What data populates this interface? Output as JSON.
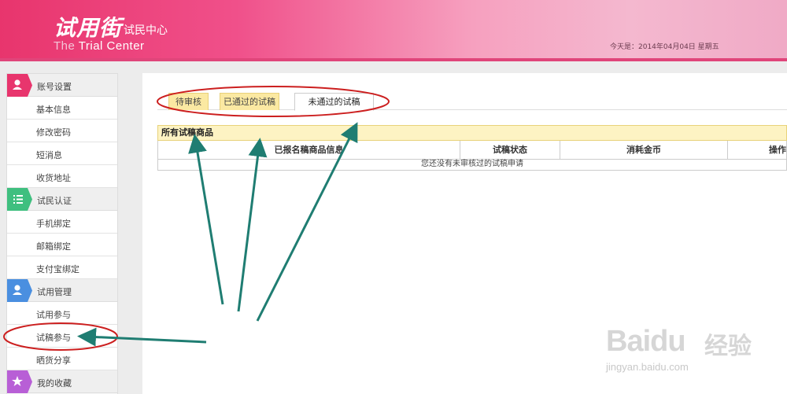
{
  "header": {
    "logo_main": "试用街",
    "logo_sub": "试民中心",
    "logo_en_the": "The",
    "logo_en_rest": " Trial Center",
    "date_text": "今天是：2014年04月04日 星期五"
  },
  "sidebar": {
    "sections": [
      {
        "title": "账号设置",
        "icon": "user-icon",
        "color": "#e8356d",
        "items": [
          "基本信息",
          "修改密码",
          "短消息",
          "收货地址"
        ]
      },
      {
        "title": "试民认证",
        "icon": "list-icon",
        "color": "#3fbf7f",
        "items": [
          "手机绑定",
          "邮箱绑定",
          "支付宝绑定"
        ]
      },
      {
        "title": "试用管理",
        "icon": "user-icon",
        "color": "#4a8fe0",
        "items": [
          "试用参与",
          "试稿参与",
          "晒货分享"
        ]
      },
      {
        "title": "我的收藏",
        "icon": "star-icon",
        "color": "#b85fd6",
        "items": []
      }
    ]
  },
  "tabs": [
    {
      "label": "待审核",
      "state": "normal"
    },
    {
      "label": "已通过的试稿",
      "state": "normal"
    },
    {
      "label": "未通过的试稿",
      "state": "active"
    }
  ],
  "table": {
    "title": "所有试稿商品",
    "columns": [
      "已报名稿商品信息",
      "试稿状态",
      "消耗金币",
      "操作"
    ],
    "empty_message": "您还没有未审核过的试稿申请"
  },
  "watermark": {
    "brand": "Baidu",
    "cn": "经验",
    "url": "jingyan.baidu.com"
  },
  "colors": {
    "header_pink": "#e8356d",
    "tab_gold": "#fbe9a2",
    "annotation_red": "#cc1f1f",
    "annotation_arrow": "#1f7d72"
  }
}
